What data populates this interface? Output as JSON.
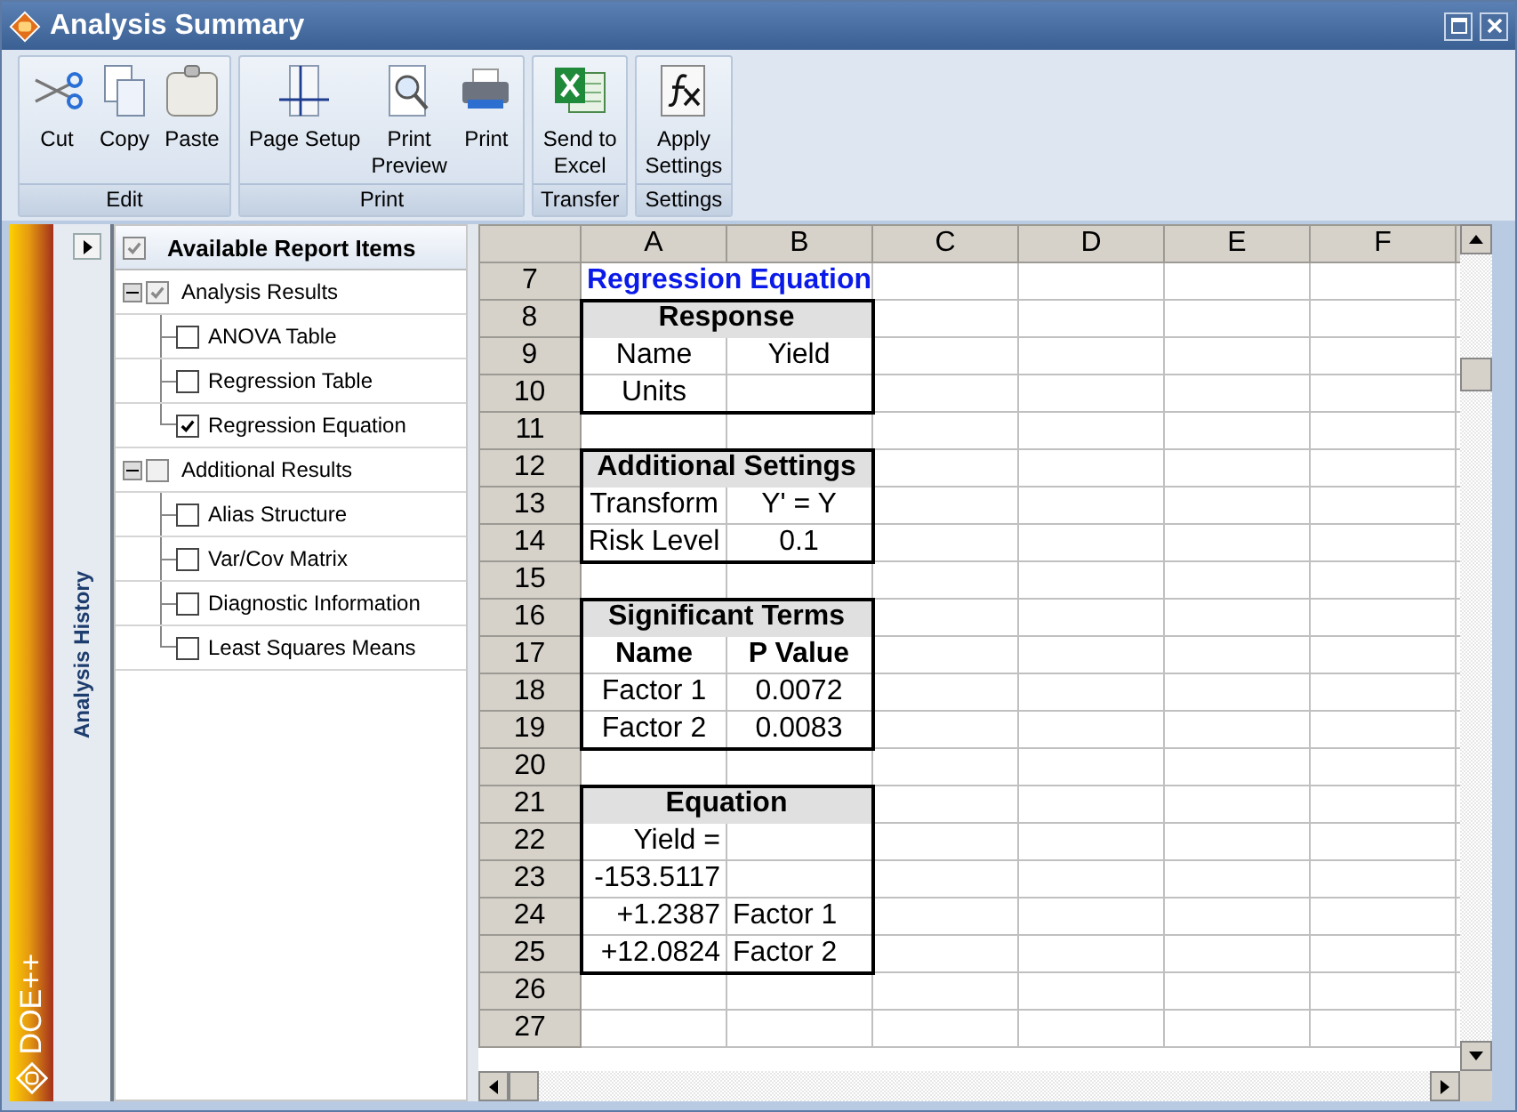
{
  "window": {
    "title": "Analysis Summary"
  },
  "ribbon": {
    "groups": [
      {
        "label": "Edit",
        "buttons": [
          {
            "label": "Cut",
            "kind": "cut"
          },
          {
            "label": "Copy",
            "kind": "copy"
          },
          {
            "label": "Paste",
            "kind": "paste"
          }
        ]
      },
      {
        "label": "Print",
        "buttons": [
          {
            "label": "Page Setup",
            "kind": "page-setup"
          },
          {
            "label": "Print\nPreview",
            "kind": "preview"
          },
          {
            "label": "Print",
            "kind": "print"
          }
        ]
      },
      {
        "label": "Transfer",
        "buttons": [
          {
            "label": "Send to\nExcel",
            "kind": "excel"
          }
        ]
      },
      {
        "label": "Settings",
        "buttons": [
          {
            "label": "Apply\nSettings",
            "kind": "function"
          }
        ]
      }
    ]
  },
  "sidebar": {
    "brand": "DOE++",
    "history_label": "Analysis History"
  },
  "report_items": {
    "label": "Available Report Items",
    "checked": true,
    "children": [
      {
        "label": "Analysis Results",
        "checked": true,
        "expanded": true,
        "children": [
          {
            "label": "ANOVA Table",
            "checked": false
          },
          {
            "label": "Regression Table",
            "checked": false
          },
          {
            "label": "Regression Equation",
            "checked": true
          }
        ]
      },
      {
        "label": "Additional Results",
        "checked": false,
        "expanded": true,
        "children": [
          {
            "label": "Alias Structure",
            "checked": false
          },
          {
            "label": "Var/Cov Matrix",
            "checked": false
          },
          {
            "label": "Diagnostic Information",
            "checked": false
          },
          {
            "label": "Least Squares Means",
            "checked": false
          }
        ]
      }
    ]
  },
  "sheet": {
    "columns": [
      "A",
      "B",
      "C",
      "D",
      "E",
      "F"
    ],
    "rows": [
      {
        "number": "7",
        "kind": "title",
        "cells": [
          "Regression Equation"
        ]
      },
      {
        "number": "8",
        "kind": "section",
        "cells": [
          {
            "text": "Response",
            "colspan": 2
          }
        ]
      },
      {
        "number": "9",
        "kind": "pair",
        "cells": [
          "Name",
          "Yield"
        ]
      },
      {
        "number": "10",
        "kind": "pair",
        "cells": [
          "Units"
        ]
      },
      {
        "number": "11",
        "kind": "empty",
        "cells": []
      },
      {
        "number": "12",
        "kind": "section",
        "cells": [
          {
            "text": "Additional Settings",
            "colspan": 2
          }
        ]
      },
      {
        "number": "13",
        "kind": "pair",
        "cells": [
          "Transform",
          "Y' = Y"
        ]
      },
      {
        "number": "14",
        "kind": "pair",
        "cells": [
          "Risk Level",
          "0.1"
        ]
      },
      {
        "number": "15",
        "kind": "empty",
        "cells": []
      },
      {
        "number": "16",
        "kind": "section",
        "cells": [
          {
            "text": "Significant Terms",
            "colspan": 2
          }
        ]
      },
      {
        "number": "17",
        "kind": "heads",
        "cells": [
          "Name",
          "P Value"
        ]
      },
      {
        "number": "18",
        "kind": "pair",
        "cells": [
          "Factor 1",
          "0.0072"
        ]
      },
      {
        "number": "19",
        "kind": "pair",
        "cells": [
          "Factor 2",
          "0.0083"
        ]
      },
      {
        "number": "20",
        "kind": "empty",
        "cells": []
      },
      {
        "number": "21",
        "kind": "section",
        "cells": [
          {
            "text": "Equation",
            "colspan": 2
          }
        ]
      },
      {
        "number": "22",
        "kind": "equation",
        "cells": [
          "Yield ="
        ]
      },
      {
        "number": "23",
        "kind": "equation",
        "cells": [
          "-153.5117"
        ]
      },
      {
        "number": "24",
        "kind": "equation",
        "cells": [
          "+1.2387",
          "Factor 1"
        ]
      },
      {
        "number": "25",
        "kind": "equation",
        "cells": [
          "+12.0824",
          "Factor 2"
        ]
      },
      {
        "number": "26",
        "kind": "empty",
        "cells": []
      },
      {
        "number": "27",
        "kind": "empty",
        "cells": []
      }
    ]
  }
}
